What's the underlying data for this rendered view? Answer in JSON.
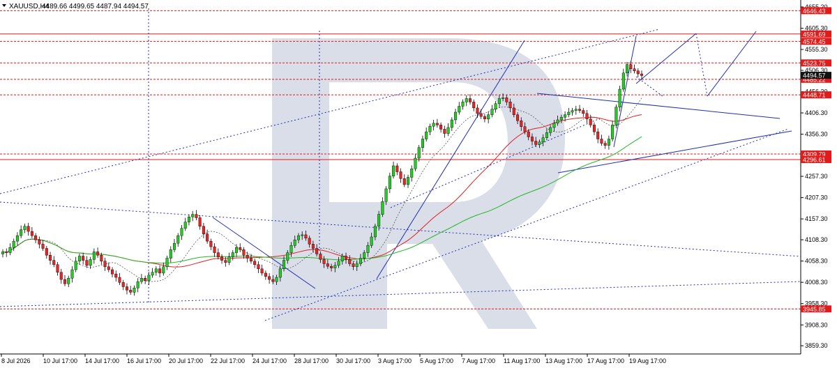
{
  "header": {
    "symbol": "XAUUSD,H4",
    "ohlc": "4489.66 4499.65 4487.94 4494.57"
  },
  "colors": {
    "bull": "#22cc22",
    "bear": "#ee2222",
    "level": "#e21a1a",
    "trend": "#1f2fb0",
    "ma_red": "#e02020",
    "ma_green": "#22b822",
    "watermark": "#ccd3e2",
    "current_tag": "#111111"
  },
  "chart_data": {
    "type": "candlestick",
    "ylim": [
      3840,
      4665
    ],
    "y_ticks": [
      "4655.20",
      "4605.30",
      "4555.30",
      "4506.30",
      "4456.30",
      "4406.30",
      "4356.30",
      "4306.30",
      "4257.30",
      "4207.30",
      "4157.30",
      "4108.30",
      "4058.30",
      "4008.30",
      "3958.30",
      "3908.30",
      "3859.30"
    ],
    "x_ticks": [
      "8 Jul 2026",
      "10 Jul 17:00",
      "14 Jul 17:00",
      "16 Jul 17:00",
      "20 Jul 17:00",
      "22 Jul 17:00",
      "24 Jul 17:00",
      "28 Jul 17:00",
      "30 Jul 17:00",
      "3 Aug 17:00",
      "5 Aug 17:00",
      "7 Aug 17:00",
      "11 Aug 17:00",
      "13 Aug 17:00",
      "17 Aug 17:00",
      "19 Aug 17:00"
    ],
    "levels": [
      {
        "price": 4646.43,
        "label": "4646.43"
      },
      {
        "price": 4591.69,
        "label": "4591.69"
      },
      {
        "price": 4574.45,
        "label": "4574.45"
      },
      {
        "price": 4523.75,
        "label": "4523.75"
      },
      {
        "price": 4485.22,
        "label": "4485.22"
      },
      {
        "price": 4448.71,
        "label": "4448.71"
      },
      {
        "price": 4309.79,
        "label": "4309.79"
      },
      {
        "price": 4296.61,
        "label": "4296.61"
      },
      {
        "price": 3945.85,
        "label": "3945.85"
      }
    ],
    "current_price": {
      "price": 4494.57,
      "label": "4494.57"
    },
    "close_series": [
      4080,
      4078,
      4090,
      4105,
      4118,
      4132,
      4140,
      4128,
      4118,
      4108,
      4098,
      4088,
      4072,
      4060,
      4050,
      4032,
      4015,
      4005,
      4018,
      4038,
      4058,
      4070,
      4060,
      4048,
      4062,
      4080,
      4072,
      4058,
      4045,
      4038,
      4028,
      4020,
      4008,
      3998,
      3990,
      3985,
      3995,
      4010,
      4018,
      4012,
      4025,
      4032,
      4040,
      4030,
      4045,
      4065,
      4085,
      4100,
      4118,
      4135,
      4150,
      4162,
      4168,
      4160,
      4140,
      4122,
      4105,
      4092,
      4078,
      4068,
      4060,
      4055,
      4068,
      4078,
      4090,
      4085,
      4072,
      4065,
      4058,
      4050,
      4040,
      4030,
      4022,
      4015,
      4010,
      4020,
      4040,
      4060,
      4078,
      4095,
      4108,
      4118,
      4120,
      4112,
      4098,
      4088,
      4075,
      4062,
      4052,
      4046,
      4042,
      4048,
      4058,
      4070,
      4062,
      4052,
      4045,
      4052,
      4065,
      4078,
      4095,
      4115,
      4140,
      4168,
      4198,
      4228,
      4258,
      4282,
      4268,
      4252,
      4238,
      4255,
      4275,
      4300,
      4325,
      4345,
      4362,
      4375,
      4382,
      4378,
      4368,
      4358,
      4372,
      4390,
      4408,
      4422,
      4432,
      4440,
      4432,
      4418,
      4405,
      4398,
      4392,
      4402,
      4415,
      4428,
      4440,
      4442,
      4432,
      4418,
      4402,
      4388,
      4374,
      4362,
      4350,
      4340,
      4332,
      4338,
      4348,
      4360,
      4372,
      4382,
      4390,
      4396,
      4402,
      4408,
      4412,
      4415,
      4412,
      4405,
      4392,
      4378,
      4362,
      4345,
      4335,
      4330,
      4345,
      4378,
      4420,
      4462,
      4500,
      4520,
      4510,
      4505,
      4498,
      4494
    ]
  }
}
